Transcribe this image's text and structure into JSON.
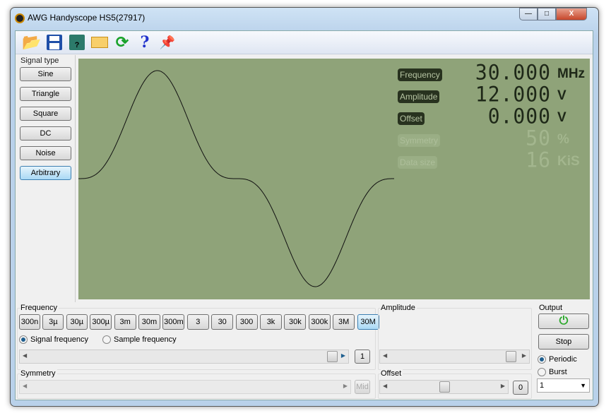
{
  "window": {
    "title": "AWG Handyscope HS5(27917)",
    "minimize": "—",
    "maximize": "□",
    "close": "X"
  },
  "toolbar": {
    "icons": [
      "open-icon",
      "save-icon",
      "save-as-icon",
      "mail-icon",
      "refresh-icon",
      "help-icon",
      "pin-icon"
    ],
    "help_glyph": "?"
  },
  "signal_type": {
    "label": "Signal type",
    "items": [
      "Sine",
      "Triangle",
      "Square",
      "DC",
      "Noise",
      "Arbitrary"
    ],
    "selected": "Arbitrary"
  },
  "display": {
    "background": "#8fa379",
    "rows": [
      {
        "label": "Frequency",
        "value": "30.000",
        "unit": "MHz",
        "active": true
      },
      {
        "label": "Amplitude",
        "value": "12.000",
        "unit": "V",
        "active": true
      },
      {
        "label": "Offset",
        "value": "0.000",
        "unit": "V",
        "active": true
      },
      {
        "label": "Symmetry",
        "value": "50",
        "unit": "%",
        "active": false
      },
      {
        "label": "Data size",
        "value": "16",
        "unit": "KiS",
        "active": false
      }
    ]
  },
  "frequency": {
    "label": "Frequency",
    "ranges": [
      "300n",
      "3µ",
      "30µ",
      "300µ",
      "3m",
      "30m",
      "300m",
      "3",
      "30",
      "300",
      "3k",
      "30k",
      "300k",
      "3M",
      "30M"
    ],
    "selected": "30M",
    "signal_frequency": "Signal frequency",
    "sample_frequency": "Sample frequency",
    "mode": "Signal frequency",
    "slider_percent": 100,
    "reset_label": "1"
  },
  "symmetry": {
    "label": "Symmetry",
    "mid_label": "Mid"
  },
  "amplitude": {
    "label": "Amplitude",
    "slider_percent": 100
  },
  "offset": {
    "label": "Offset",
    "slider_percent": 50,
    "reset_label": "0"
  },
  "output": {
    "label": "Output",
    "power_icon": "power-icon",
    "power_color": "#2aa82a",
    "stop_label": "Stop",
    "periodic": "Periodic",
    "burst": "Burst",
    "mode": "Periodic",
    "burst_count": "1"
  }
}
